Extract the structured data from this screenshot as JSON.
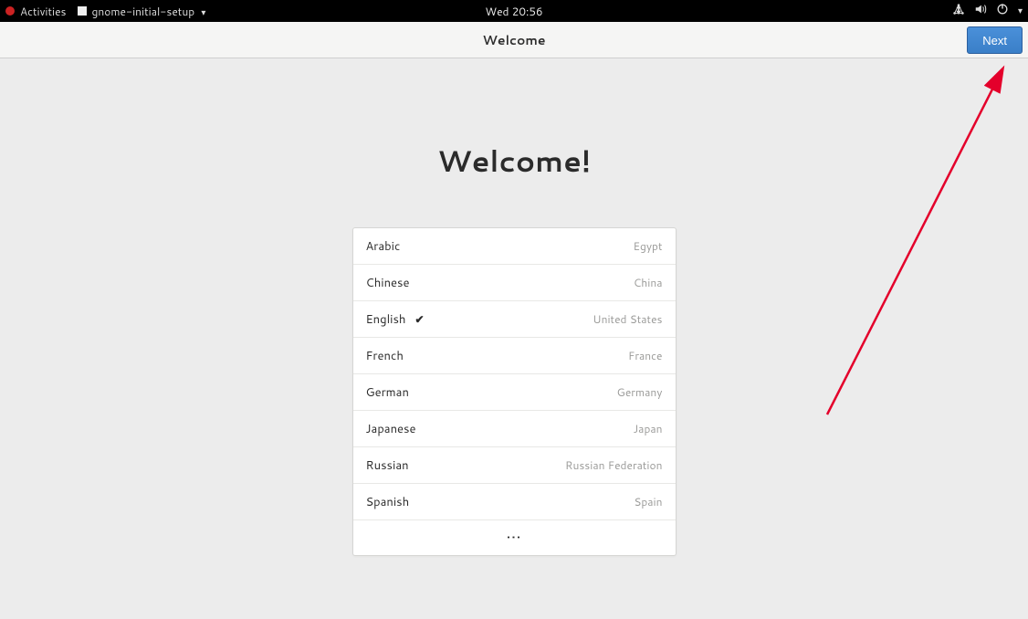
{
  "topbar": {
    "activities_label": "Activities",
    "app_name": "gnome-initial-setup",
    "clock": "Wed 20:56"
  },
  "headerbar": {
    "title": "Welcome",
    "next_label": "Next"
  },
  "main": {
    "heading": "Welcome!",
    "languages": [
      {
        "name": "Arabic",
        "country": "Egypt",
        "selected": false
      },
      {
        "name": "Chinese",
        "country": "China",
        "selected": false
      },
      {
        "name": "English",
        "country": "United States",
        "selected": true
      },
      {
        "name": "French",
        "country": "France",
        "selected": false
      },
      {
        "name": "German",
        "country": "Germany",
        "selected": false
      },
      {
        "name": "Japanese",
        "country": "Japan",
        "selected": false
      },
      {
        "name": "Russian",
        "country": "Russian Federation",
        "selected": false
      },
      {
        "name": "Spanish",
        "country": "Spain",
        "selected": false
      }
    ],
    "more_glyph": "⋮"
  }
}
